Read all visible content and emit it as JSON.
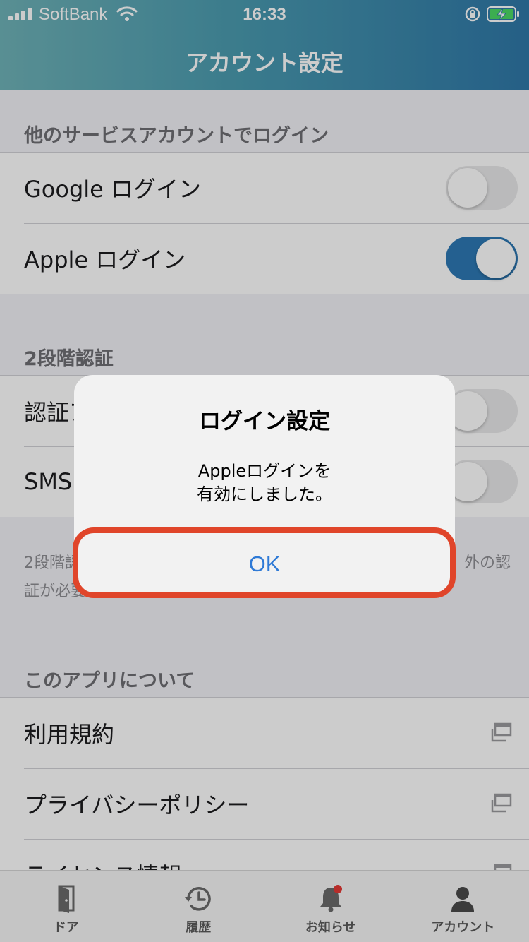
{
  "status_bar": {
    "carrier": "SoftBank",
    "time": "16:33"
  },
  "header": {
    "title": "アカウント設定"
  },
  "sections": {
    "other_login": {
      "title": "他のサービスアカウントでログイン",
      "rows": [
        {
          "label": "Google ログイン",
          "toggle": "off"
        },
        {
          "label": "Apple ログイン",
          "toggle": "on"
        }
      ]
    },
    "two_factor": {
      "title": "2段階認証",
      "rows": [
        {
          "label": "認証ア",
          "toggle": "off"
        },
        {
          "label": "SMS",
          "toggle": "off"
        }
      ],
      "footnote_line1_left": "2段階認",
      "footnote_line1_right": "外の認",
      "footnote_line2": "証が必要"
    },
    "about": {
      "title": "このアプリについて",
      "rows": [
        {
          "label": "利用規約"
        },
        {
          "label": "プライバシーポリシー"
        },
        {
          "label": "ライセンス情報"
        }
      ]
    }
  },
  "alert": {
    "title": "ログイン設定",
    "message_line1": "Appleログインを",
    "message_line2": "有効にしました。",
    "ok_label": "OK"
  },
  "tabbar": {
    "items": [
      {
        "label": "ドア",
        "icon": "door-icon"
      },
      {
        "label": "履歴",
        "icon": "history-icon"
      },
      {
        "label": "お知らせ",
        "icon": "bell-icon"
      },
      {
        "label": "アカウント",
        "icon": "person-icon"
      }
    ]
  },
  "colors": {
    "header_gradient_start": "#6fb3b8",
    "header_gradient_end": "#2f78a8",
    "toggle_on": "#2d79b5",
    "alert_button": "#2f7ad6",
    "highlight_border": "#e0452a",
    "notification_dot": "#e53935"
  }
}
